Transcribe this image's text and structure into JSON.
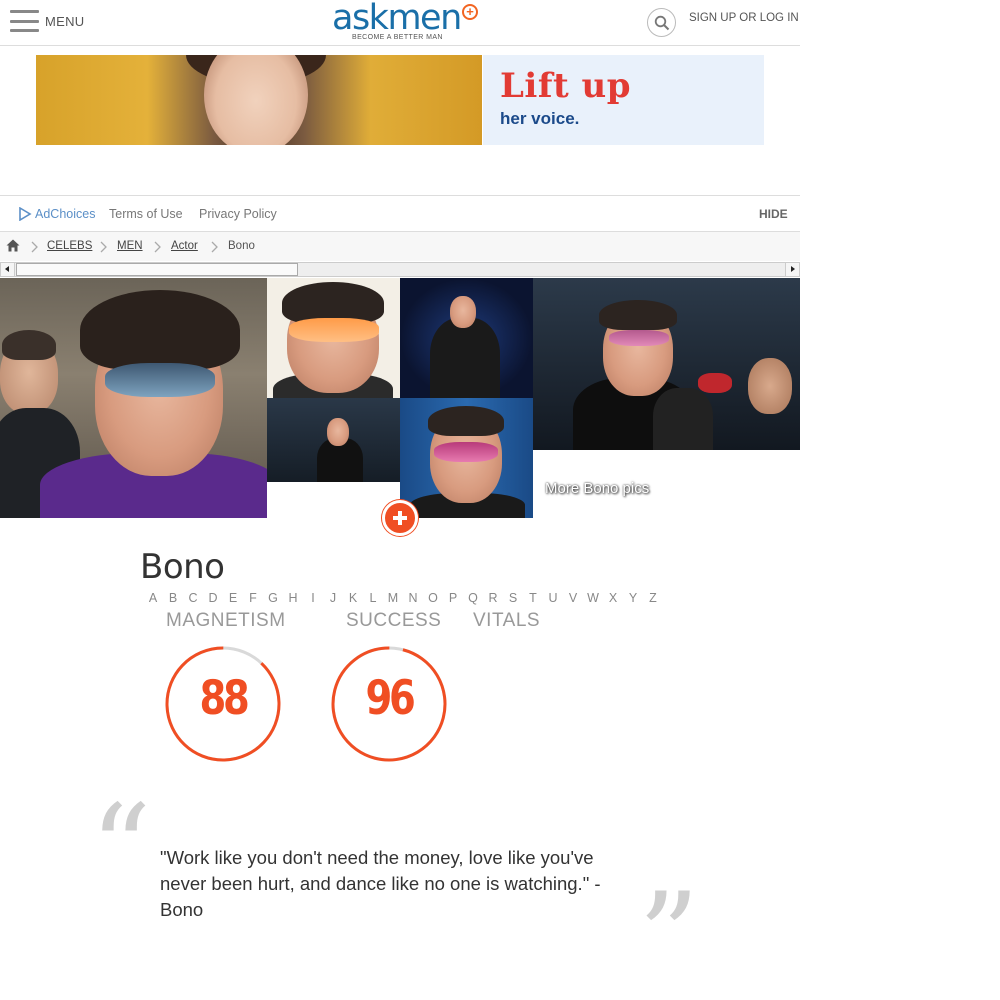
{
  "header": {
    "menu_label": "MENU",
    "logo_text": "askmen",
    "logo_tagline": "BECOME A BETTER MAN",
    "signup_label": "SIGN UP OR LOG IN"
  },
  "ad": {
    "headline": "Lift up",
    "subline": "her voice."
  },
  "ad_bar": {
    "adchoices": "AdChoices",
    "terms": "Terms of Use",
    "privacy": "Privacy Policy",
    "hide": "HIDE"
  },
  "breadcrumb": {
    "items": [
      "CELEBS",
      "MEN",
      "Actor",
      "Bono"
    ]
  },
  "gallery": {
    "more_pics": "More Bono pics"
  },
  "celeb": {
    "name": "Bono",
    "alphabet": [
      "A",
      "B",
      "C",
      "D",
      "E",
      "F",
      "G",
      "H",
      "I",
      "J",
      "K",
      "L",
      "M",
      "N",
      "O",
      "P",
      "Q",
      "R",
      "S",
      "T",
      "U",
      "V",
      "W",
      "X",
      "Y",
      "Z"
    ]
  },
  "tabs": [
    "MAGNETISM",
    "SUCCESS",
    "VITALS"
  ],
  "scores": {
    "magnetism": {
      "value": "88",
      "fraction": 0.88
    },
    "success": {
      "value": "96",
      "fraction": 0.96
    }
  },
  "quote": {
    "text": "\"Work like you don't need the money, love like you've never been hurt, and dance like no one is watching.\" - Bono"
  },
  "colors": {
    "brand_blue": "#1a6fa8",
    "accent_orange": "#f04e23",
    "gauge_track": "#d9d9d9"
  }
}
